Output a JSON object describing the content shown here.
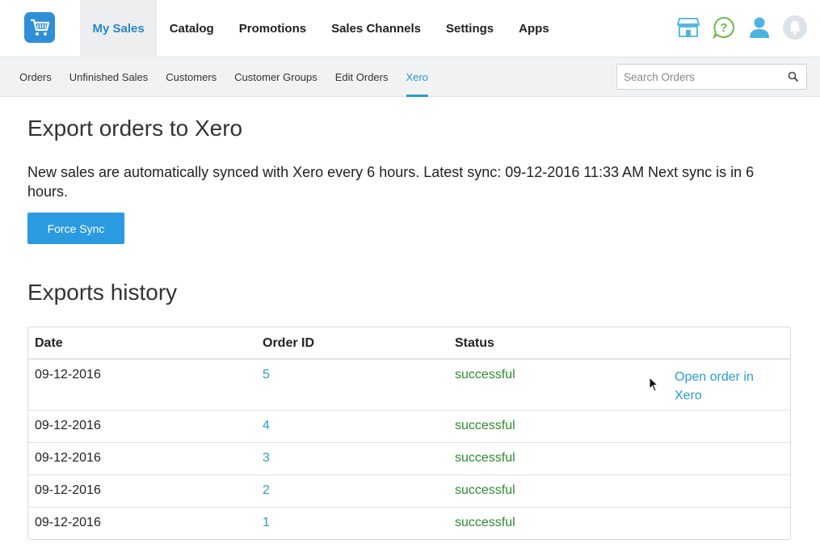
{
  "topnav": {
    "items": [
      "My Sales",
      "Catalog",
      "Promotions",
      "Sales Channels",
      "Settings",
      "Apps"
    ],
    "active": "My Sales"
  },
  "icons": {
    "logo": "cart-logo-icon",
    "store": "storefront-icon",
    "help": "help-chat-icon",
    "user": "user-icon",
    "notifications": "bell-icon",
    "search": "search-icon"
  },
  "subnav": {
    "items": [
      "Orders",
      "Unfinished Sales",
      "Customers",
      "Customer Groups",
      "Edit Orders",
      "Xero"
    ],
    "active": "Xero"
  },
  "search": {
    "placeholder": "Search Orders",
    "value": ""
  },
  "page": {
    "title": "Export orders to Xero",
    "description": "New sales are automatically synced with Xero every 6 hours. Latest sync: 09-12-2016 11:33 AM Next sync is in 6 hours.",
    "force_sync_label": "Force Sync",
    "history_title": "Exports history"
  },
  "history": {
    "columns": [
      "Date",
      "Order ID",
      "Status"
    ],
    "rows": [
      {
        "date": "09-12-2016",
        "order_id": "5",
        "status": "successful",
        "action": "Open order in Xero"
      },
      {
        "date": "09-12-2016",
        "order_id": "4",
        "status": "successful",
        "action": ""
      },
      {
        "date": "09-12-2016",
        "order_id": "3",
        "status": "successful",
        "action": ""
      },
      {
        "date": "09-12-2016",
        "order_id": "2",
        "status": "successful",
        "action": ""
      },
      {
        "date": "09-12-2016",
        "order_id": "1",
        "status": "successful",
        "action": ""
      }
    ]
  },
  "colors": {
    "accent": "#2a9bd0",
    "button": "#2a9be0",
    "success": "#2e8b2e",
    "active_tab_bg": "#eceef0"
  }
}
